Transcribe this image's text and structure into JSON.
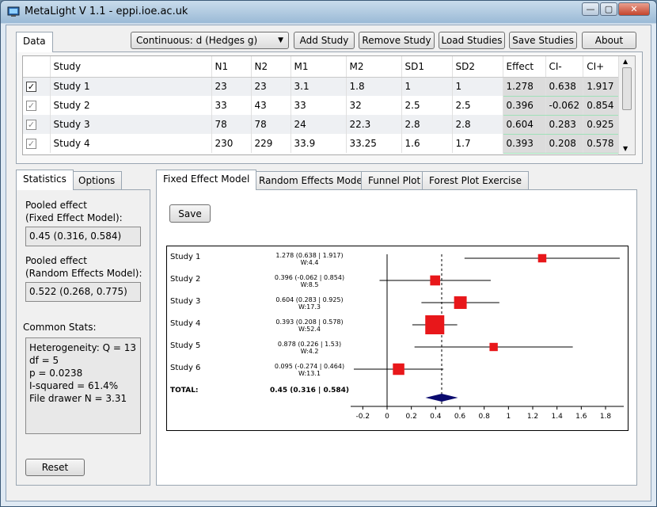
{
  "window": {
    "title": "MetaLight V 1.1 - eppi.ioe.ac.uk",
    "minimize": "—",
    "maximize": "▢",
    "close": "✕"
  },
  "top_tab": "Data",
  "toolbar": {
    "outcome_select": "Continuous: d (Hedges g)",
    "add_study": "Add Study",
    "remove_study": "Remove Study",
    "load_studies": "Load Studies",
    "save_studies": "Save Studies",
    "about": "About"
  },
  "grid": {
    "columns": [
      "",
      "Study",
      "N1",
      "N2",
      "M1",
      "M2",
      "SD1",
      "SD2",
      "Effect",
      "CI-",
      "CI+"
    ],
    "rows": [
      {
        "checked": true,
        "cells": [
          "Study 1",
          "23",
          "23",
          "3.1",
          "1.8",
          "1",
          "1",
          "1.278",
          "0.638",
          "1.917"
        ]
      },
      {
        "checked": true,
        "cells": [
          "Study 2",
          "33",
          "43",
          "33",
          "32",
          "2.5",
          "2.5",
          "0.396",
          "-0.062",
          "0.854"
        ]
      },
      {
        "checked": true,
        "cells": [
          "Study 3",
          "78",
          "78",
          "24",
          "22.3",
          "2.8",
          "2.8",
          "0.604",
          "0.283",
          "0.925"
        ]
      },
      {
        "checked": true,
        "cells": [
          "Study 4",
          "230",
          "229",
          "33.9",
          "33.25",
          "1.6",
          "1.7",
          "0.393",
          "0.208",
          "0.578"
        ]
      }
    ]
  },
  "left_tabs": [
    "Statistics",
    "Options"
  ],
  "stats": {
    "pooled_fixed_label_1": "Pooled effect",
    "pooled_fixed_label_2": "(Fixed Effect Model):",
    "pooled_fixed_value": "0.45 (0.316, 0.584)",
    "pooled_random_label_1": "Pooled effect",
    "pooled_random_label_2": "(Random Effects Model):",
    "pooled_random_value": "0.522 (0.268, 0.775)",
    "common_label": "Common Stats:",
    "common_lines": [
      "Heterogeneity: Q = 13",
      "df = 5",
      "p = 0.0238",
      "I-squared = 61.4%",
      "File drawer N = 3.31"
    ],
    "reset": "Reset"
  },
  "right_tabs": [
    "Fixed Effect Model",
    "Random Effects Model",
    "Funnel Plot",
    "Forest Plot Exercise"
  ],
  "save_button": "Save",
  "forest": {
    "studies": [
      {
        "name": "Study 1",
        "ci_text": "1.278 (0.638 | 1.917)",
        "w_text": "W:4.4",
        "effect": 1.278,
        "lo": 0.638,
        "hi": 1.917,
        "weight": 4.4
      },
      {
        "name": "Study 2",
        "ci_text": "0.396 (-0.062 | 0.854)",
        "w_text": "W:8.5",
        "effect": 0.396,
        "lo": -0.062,
        "hi": 0.854,
        "weight": 8.5
      },
      {
        "name": "Study 3",
        "ci_text": "0.604 (0.283 | 0.925)",
        "w_text": "W:17.3",
        "effect": 0.604,
        "lo": 0.283,
        "hi": 0.925,
        "weight": 17.3
      },
      {
        "name": "Study 4",
        "ci_text": "0.393 (0.208 | 0.578)",
        "w_text": "W:52.4",
        "effect": 0.393,
        "lo": 0.208,
        "hi": 0.578,
        "weight": 52.4
      },
      {
        "name": "Study 5",
        "ci_text": "0.878 (0.226 | 1.53)",
        "w_text": "W:4.2",
        "effect": 0.878,
        "lo": 0.226,
        "hi": 1.53,
        "weight": 4.2
      },
      {
        "name": "Study 6",
        "ci_text": "0.095 (-0.274 | 0.464)",
        "w_text": "W:13.1",
        "effect": 0.095,
        "lo": -0.274,
        "hi": 0.464,
        "weight": 13.1
      }
    ],
    "total": {
      "name": "TOTAL:",
      "ci_text": "0.45 (0.316 | 0.584)",
      "effect": 0.45,
      "lo": 0.316,
      "hi": 0.584
    },
    "axis_min": -0.3,
    "axis_max": 1.95,
    "ticks": [
      -0.2,
      0,
      0.2,
      0.4,
      0.6,
      0.8,
      1,
      1.2,
      1.4,
      1.6,
      1.8
    ],
    "tick_labels": [
      "-0.2",
      "0",
      "0.2",
      "0.4",
      "0.6",
      "0.8",
      "1",
      "1.2",
      "1.4",
      "1.6",
      "1.8"
    ],
    "colors": {
      "marker": "#e8171a",
      "diamond": "#0a0a6e",
      "line": "#000000"
    }
  }
}
